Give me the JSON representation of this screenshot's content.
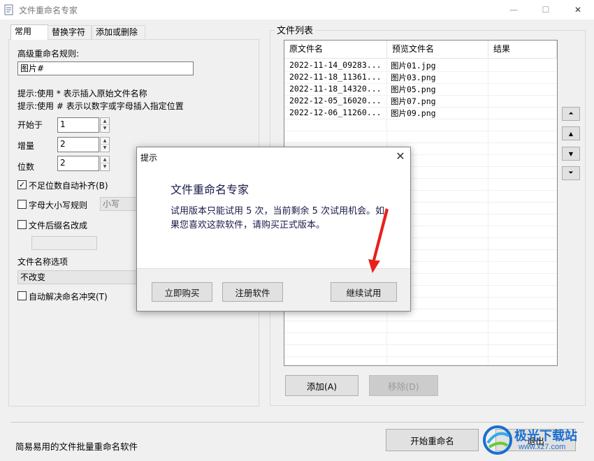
{
  "window": {
    "title": "文件重命名专家",
    "minimize": "—",
    "maximize": "☐",
    "close": "✕"
  },
  "tabs": [
    "常用",
    "替换字符",
    "添加或删除"
  ],
  "common": {
    "rule_label": "高级重命名规则:",
    "rule_value": "图片#",
    "hint1": "提示:使用 * 表示插入原始文件名称",
    "hint2": "提示:使用 # 表示以数字或字母插入指定位置",
    "start_label": "开始于",
    "start_value": "1",
    "increment_label": "增量",
    "increment_value": "2",
    "digits_label": "位数",
    "digits_value": "2",
    "pad_label": "不足位数自动补齐(B)",
    "pad_checked": true,
    "case_label": "字母大小写规则",
    "case_checked": false,
    "case_value": "小写",
    "ext_label": "文件后缀名改成",
    "ext_checked": false,
    "ext_value": "",
    "name_option_label": "文件名称选项",
    "name_option_value": "不改变",
    "conflict_label": "自动解决命名冲突(T)",
    "conflict_checked": false
  },
  "file_list": {
    "title": "文件列表",
    "columns": [
      "原文件名",
      "预览文件名",
      "结果"
    ],
    "rows": [
      {
        "original": "2022-11-14_09283...",
        "preview": "图片01.jpg",
        "result": ""
      },
      {
        "original": "2022-11-18_11361...",
        "preview": "图片03.png",
        "result": ""
      },
      {
        "original": "2022-11-18_14320...",
        "preview": "图片05.png",
        "result": ""
      },
      {
        "original": "2022-12-05_16020...",
        "preview": "图片07.png",
        "result": ""
      },
      {
        "original": "2022-12-06_11260...",
        "preview": "图片09.png",
        "result": ""
      }
    ],
    "add_button": "添加(A)",
    "remove_button": "移除(D)"
  },
  "side_buttons": {
    "top": "⏶",
    "up": "▲",
    "down": "▼",
    "bottom": "⏷"
  },
  "bottom": {
    "status": "简易易用的文件批量重命名软件",
    "start_button": "开始重命名",
    "exit_button": "退出"
  },
  "dialog": {
    "title": "提示",
    "close": "✕",
    "heading": "文件重命名专家",
    "message": "试用版本只能试用 5 次，当前剩余 5 次试用机会。如果您喜欢这款软件，请购买正式版本。",
    "buy_button": "立即购买",
    "register_button": "注册软件",
    "continue_button": "继续试用"
  },
  "watermark": {
    "brand": "极光下载站",
    "url": "www.xz7.com"
  },
  "colors": {
    "arrow": "#e8201c",
    "watermark_blue": "#1a6fd1"
  }
}
